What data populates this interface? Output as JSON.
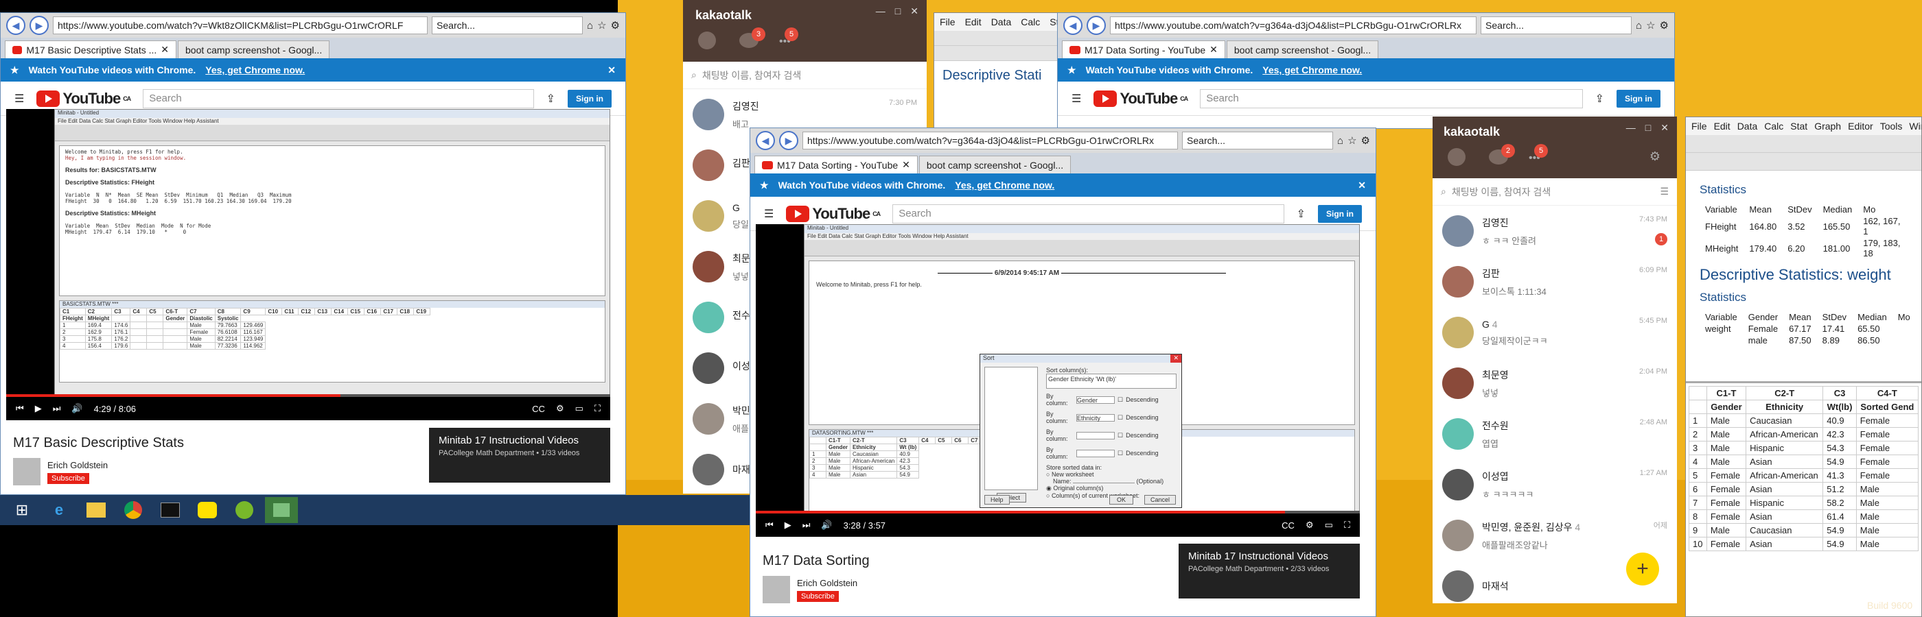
{
  "left_browser": {
    "url": "https://www.youtube.com/watch?v=Wkt8zOlICKM&list=PLCRbGgu-O1rwCrORLF",
    "search_placeholder": "Search...",
    "tabs": [
      {
        "label": "M17 Basic Descriptive Stats ..."
      },
      {
        "label": "boot camp screenshot - Googl..."
      }
    ],
    "banner": {
      "text": "Watch YouTube videos with Chrome.",
      "link": "Yes, get Chrome now."
    },
    "yt_search_placeholder": "Search",
    "region": "CA",
    "signin": "Sign in",
    "video": {
      "time": "4:29 / 8:06",
      "progress": 0.553,
      "session_lines": [
        "Welcome to Minitab, press F1 for help.",
        "Hey, I am typing in the session window.",
        "",
        "Results for: BASICSTATS.MTW",
        "",
        "Descriptive Statistics: FHeight",
        "",
        "Variable  N  N*  Mean  SE Mean  StDev  Minimum   Q1  Median   Q3  Maximum",
        "FHeight  30   0  164.80   1.20  6.59  151.70 160.23 164.30 169.04  179.20",
        "",
        "Descriptive Statistics: MHeight",
        "",
        "Variable  Mean  StDev  Median  Mode  N for Mode",
        "MHeight  179.47  6.14  179.10   *     0"
      ],
      "sheet_title": "BASICSTATS.MTW ***",
      "sheet_headers": [
        "C1",
        "C2",
        "C3",
        "C4",
        "C5",
        "C6-T",
        "C7",
        "C8",
        "C9",
        "C10",
        "C11",
        "C12",
        "C13",
        "C14",
        "C15",
        "C16",
        "C17",
        "C18",
        "C19"
      ],
      "sheet_names": [
        "FHeight",
        "MHeight",
        "",
        "",
        "",
        "Gender",
        "Diastolic",
        "Systolic"
      ],
      "sheet_rows": [
        [
          "1",
          "169.4",
          "174.6",
          "",
          "",
          "",
          "Male",
          "79.7663",
          "129.469"
        ],
        [
          "2",
          "162.9",
          "176.1",
          "",
          "",
          "",
          "Female",
          "76.6108",
          "116.167"
        ],
        [
          "3",
          "175.8",
          "176.2",
          "",
          "",
          "",
          "Male",
          "82.2214",
          "123.949"
        ],
        [
          "4",
          "156.4",
          "179.6",
          "",
          "",
          "",
          "Male",
          "77.3236",
          "114.962"
        ]
      ]
    },
    "title": "M17 Basic Descriptive Stats",
    "channel": "Erich Goldstein",
    "subscribe": "Subscribe",
    "playlist": {
      "title": "Minitab 17 Instructional Videos",
      "sub": "PACollege Math Department • 1/33 videos"
    }
  },
  "center_browser": {
    "url": "https://www.youtube.com/watch?v=g364a-d3jO4&list=PLCRbGgu-O1rwCrORLRx",
    "search_placeholder": "Search...",
    "tabs": [
      {
        "label": "M17 Data Sorting - YouTube"
      },
      {
        "label": "boot camp screenshot - Googl..."
      }
    ],
    "banner": {
      "text": "Watch YouTube videos with Chrome.",
      "link": "Yes, get Chrome now."
    },
    "yt_search_placeholder": "Search",
    "region": "CA",
    "signin": "Sign in",
    "video": {
      "time": "3:28 / 3:57",
      "progress": 0.876,
      "session_date": "6/9/2014 9:45:17 AM",
      "session_line": "Welcome to Minitab, press F1 for help.",
      "dialog": {
        "title": "Sort",
        "sort_columns_label": "Sort column(s):",
        "sort_columns_value": "Gender Ethnicity 'Wt (lb)'",
        "by_label": "By column:",
        "by_values": [
          "Gender",
          "Ethnicity",
          "",
          ""
        ],
        "descending": "Descending",
        "store_label": "Store sorted data in:",
        "options": [
          "New worksheet",
          "Original column(s)",
          "Column(s) of current worksheet:"
        ],
        "name_label": "Name:",
        "optional": "(Optional)",
        "buttons": [
          "Select",
          "Help",
          "OK",
          "Cancel"
        ]
      },
      "sheet_title": "DATASORTING.MTW ***",
      "sheet_headers": [
        "",
        "C1-T",
        "C2-T",
        "C3",
        "C4",
        "C5",
        "C6",
        "C7",
        "C8",
        "C9",
        "C10",
        "C11",
        "C12",
        "C13",
        "C14",
        "C15",
        "C16",
        "C17",
        "C18"
      ],
      "sheet_names": [
        "",
        "Gender",
        "Ethnicity",
        "Wt (lb)"
      ],
      "sheet_rows": [
        [
          "1",
          "Male",
          "Caucasian",
          "40.9"
        ],
        [
          "2",
          "Male",
          "African-American",
          "42.3"
        ],
        [
          "3",
          "Male",
          "Hispanic",
          "54.3"
        ],
        [
          "4",
          "Male",
          "Asian",
          "54.9"
        ]
      ]
    },
    "title": "M17 Data Sorting",
    "channel": "Erich Goldstein",
    "subscribe": "Subscribe",
    "playlist": {
      "title": "Minitab 17 Instructional Videos",
      "sub": "PACollege Math Department • 2/33 videos"
    }
  },
  "back_browser": {
    "url": "https://www.youtube.com/watch?v=g364a-d3jO4&list=PLCRbGgu-O1rwCrORLRx",
    "search_placeholder": "Search...",
    "tabs": [
      {
        "label": "M17 Data Sorting - YouTube"
      },
      {
        "label": "boot camp screenshot - Googl..."
      }
    ],
    "banner": {
      "text": "Watch YouTube videos with Chrome.",
      "link": "Yes, get Chrome now."
    },
    "yt_search_placeholder": "Search",
    "region": "CA",
    "signin": "Sign in"
  },
  "back_kakao": {
    "brand": "kakaotalk",
    "badges": [
      "3",
      "5"
    ],
    "search_placeholder": "채팅방 이름, 참여자 검색",
    "chats": [
      {
        "name": "김영진",
        "msg": "배고",
        "time": "7:30 PM"
      },
      {
        "name": "김판",
        "msg": "",
        "time": ""
      },
      {
        "name": "G",
        "msg": "당일",
        "time": ""
      },
      {
        "name": "최문",
        "msg": "넣넣",
        "time": ""
      },
      {
        "name": "전수",
        "msg": "",
        "time": ""
      },
      {
        "name": "이성",
        "msg": "",
        "time": ""
      },
      {
        "name": "박민",
        "msg": "애플",
        "time": ""
      },
      {
        "name": "마재",
        "msg": "",
        "time": ""
      }
    ]
  },
  "kakao": {
    "brand": "kakaotalk",
    "badges": [
      "2",
      "5"
    ],
    "search_placeholder": "채팅방 이름, 참여자 검색",
    "chats": [
      {
        "name": "김영진",
        "msg": "ㅎ ㅋㅋ 안졸려",
        "time": "7:43 PM",
        "unread": "1"
      },
      {
        "name": "김판",
        "msg": "보이스톡 1:11:34",
        "time": "6:09 PM",
        "unread": ""
      },
      {
        "name": "G",
        "count": "4",
        "msg": "당일제작이군ㅋㅋ",
        "time": "5:45 PM",
        "unread": ""
      },
      {
        "name": "최문영",
        "msg": "넣넣",
        "time": "2:04 PM",
        "unread": ""
      },
      {
        "name": "전수원",
        "msg": "엽엽",
        "time": "2:48 AM",
        "unread": ""
      },
      {
        "name": "이성엽",
        "msg": "ㅎ ㅋㅋㅋㅋㅋ",
        "time": "1:27 AM",
        "unread": ""
      },
      {
        "name": "박민영, 윤준원, 김상우",
        "count": "4",
        "msg": "애플팔래조앙같나",
        "time": "어제",
        "unread": ""
      },
      {
        "name": "마재석",
        "msg": "",
        "time": "",
        "unread": ""
      }
    ],
    "fab": "+"
  },
  "back_minitab": {
    "menu": [
      "File",
      "Edit",
      "Data",
      "Calc",
      "Stat"
    ],
    "heading": "Descriptive Stati"
  },
  "right_minitab": {
    "menu": [
      "File",
      "Edit",
      "Data",
      "Calc",
      "Stat",
      "Graph",
      "Editor",
      "Tools",
      "Windo"
    ],
    "stats1_heading": "Statistics",
    "stats1_headers": [
      "Variable",
      "Mean",
      "StDev",
      "Median",
      "Mo"
    ],
    "stats1_rows": [
      [
        "FHeight",
        "164.80",
        "3.52",
        "165.50",
        "162, 167, 1"
      ],
      [
        "MHeight",
        "179.40",
        "6.20",
        "181.00",
        "179, 183, 18"
      ]
    ],
    "h2": "Descriptive Statistics: weight",
    "stats2_heading": "Statistics",
    "stats2_headers": [
      "Variable",
      "Gender",
      "Mean",
      "StDev",
      "Median",
      "Mo"
    ],
    "stats2_rows": [
      [
        "weight",
        "Female",
        "67.17",
        "17.41",
        "65.50",
        ""
      ],
      [
        "",
        "male",
        "87.50",
        "8.89",
        "86.50",
        ""
      ]
    ],
    "ws_headers": [
      "",
      "C1-T",
      "C2-T",
      "C3",
      "C4-T"
    ],
    "ws_names": [
      "",
      "Gender",
      "Ethnicity",
      "Wt(lb)",
      "Sorted Gend"
    ],
    "ws_rows": [
      [
        "1",
        "Male",
        "Caucasian",
        "40.9",
        "Female"
      ],
      [
        "2",
        "Male",
        "African-American",
        "42.3",
        "Female"
      ],
      [
        "3",
        "Male",
        "Hispanic",
        "54.3",
        "Female"
      ],
      [
        "4",
        "Male",
        "Asian",
        "54.9",
        "Female"
      ],
      [
        "5",
        "Female",
        "African-American",
        "41.3",
        "Female"
      ],
      [
        "6",
        "Female",
        "Asian",
        "51.2",
        "Male"
      ],
      [
        "7",
        "Female",
        "Hispanic",
        "58.2",
        "Male"
      ],
      [
        "8",
        "Female",
        "Asian",
        "61.4",
        "Male"
      ],
      [
        "9",
        "Male",
        "Caucasian",
        "54.9",
        "Male"
      ],
      [
        "10",
        "Female",
        "Asian",
        "54.9",
        "Male"
      ]
    ]
  },
  "build": "Build 9600",
  "taskbar": {
    "items": [
      "start-icon",
      "ie-icon",
      "explorer-icon",
      "chrome-icon",
      "cmd-icon",
      "kakaotalk-icon",
      "utorrent-icon",
      "minitab-icon"
    ]
  },
  "colors": {
    "desktop": "#f1b41e",
    "yt_blue": "#167ac6",
    "yt_red": "#e62117",
    "kakao_head": "#4e3b33"
  }
}
